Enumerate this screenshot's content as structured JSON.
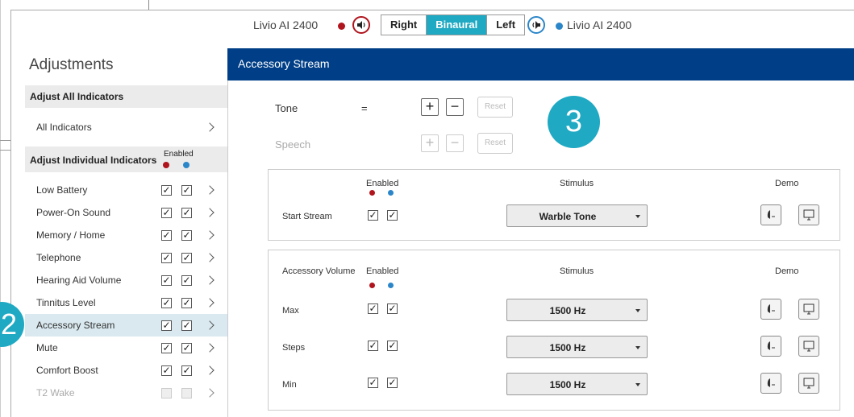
{
  "header": {
    "left_device": "Livio AI 2400",
    "right_device": "Livio AI 2400",
    "segments": [
      "Right",
      "Binaural",
      "Left"
    ],
    "selected_segment": "Binaural"
  },
  "left": {
    "title": "Adjustments",
    "section_all": "Adjust All Indicators",
    "all_indicators": "All Indicators",
    "section_individual": "Adjust Individual Indicators",
    "enabled_label": "Enabled",
    "items": [
      {
        "label": "Low Battery",
        "left": true,
        "right": true
      },
      {
        "label": "Power-On Sound",
        "left": true,
        "right": true
      },
      {
        "label": "Memory / Home",
        "left": true,
        "right": true
      },
      {
        "label": "Telephone",
        "left": true,
        "right": true
      },
      {
        "label": "Hearing Aid Volume",
        "left": true,
        "right": true
      },
      {
        "label": "Tinnitus Level",
        "left": true,
        "right": true
      },
      {
        "label": "Accessory Stream",
        "left": true,
        "right": true,
        "selected": true
      },
      {
        "label": "Mute",
        "left": true,
        "right": true
      },
      {
        "label": "Comfort Boost",
        "left": true,
        "right": true
      },
      {
        "label": "T2 Wake",
        "left": false,
        "right": false,
        "disabled": true
      }
    ]
  },
  "main": {
    "title": "Accessory Stream",
    "tone_label": "Tone",
    "tone_eq": "=",
    "speech_label": "Speech",
    "reset_label": "Reset",
    "badge_3": "3",
    "badge_2": "2",
    "card1": {
      "enabled_label": "Enabled",
      "stimulus_label": "Stimulus",
      "demo_label": "Demo",
      "row_label": "Start Stream",
      "stimulus_value": "Warble Tone"
    },
    "card2": {
      "title": "Accessory Volume",
      "enabled_label": "Enabled",
      "stimulus_label": "Stimulus",
      "demo_label": "Demo",
      "rows": [
        {
          "label": "Max",
          "value": "1500 Hz"
        },
        {
          "label": "Steps",
          "value": "1500 Hz"
        },
        {
          "label": "Min",
          "value": "1500 Hz"
        }
      ]
    }
  },
  "colors": {
    "accent": "#1fa9c3",
    "navy": "#003f87",
    "left_ear": "#b0141d",
    "right_ear": "#2b86c9"
  }
}
